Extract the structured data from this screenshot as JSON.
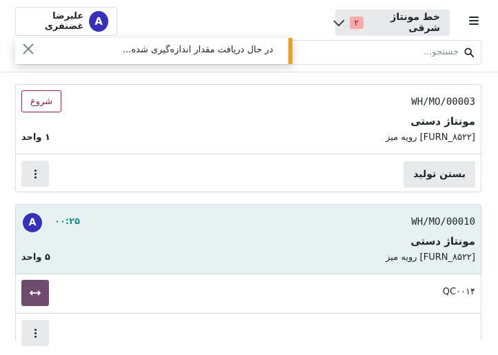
{
  "header": {
    "workcenter_label": "خط مونتاژ شرقی",
    "workcenter_badge": "۲",
    "employee_name": "علیرضا غضنفری",
    "employee_initial": "A"
  },
  "search": {
    "placeholder": "جستجو..."
  },
  "toast": {
    "message": "در حال دریافت مقدار اندازه‌گیری شده..."
  },
  "cards": [
    {
      "mo": "WH/MO/00003",
      "operation": "مونتاژ دستی",
      "product": "[FURN_۸۵۲۲] رویه میز",
      "quantity": "۱ واحد",
      "start_label": "شروع",
      "close_label": "بستن تولید"
    },
    {
      "mo": "WH/MO/00010",
      "operation": "مونتاژ دستی",
      "product": "[FURN_۸۵۲۲] رویه میز",
      "quantity": "۵ واحد",
      "timer": "۰۰:۲۵",
      "avatar_initial": "A",
      "step_label": "QC۰۰۱۴"
    }
  ],
  "colors": {
    "accent": "#8f2147",
    "warning": "#e8a12a",
    "avatar": "#3730b8",
    "timer": "#1b8d8d",
    "active_card_bg": "#e6f1f1",
    "action_button": "#6f4c6e"
  },
  "icons": [
    "hamburger-icon",
    "chevron-down-icon",
    "search-icon",
    "close-icon",
    "kebab-icon",
    "arrows-horizontal-icon"
  ]
}
